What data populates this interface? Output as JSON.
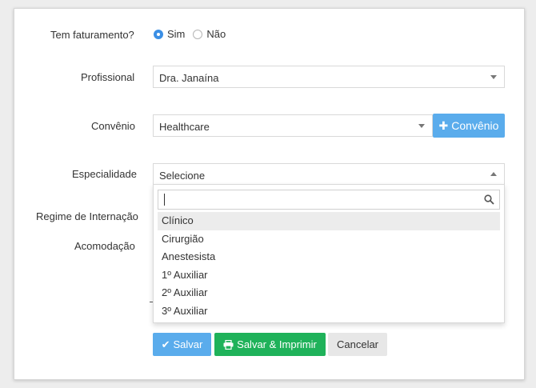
{
  "form": {
    "billing": {
      "label": "Tem faturamento?",
      "options": [
        {
          "label": "Sim",
          "selected": true
        },
        {
          "label": "Não",
          "selected": false
        }
      ]
    },
    "professional": {
      "label": "Profissional",
      "value": "Dra. Janaína"
    },
    "insurance": {
      "label": "Convênio",
      "value": "Healthcare",
      "add_button": "Convênio",
      "add_icon": "plus-icon"
    },
    "specialty": {
      "label": "Especialidade",
      "value": "Selecione",
      "search_value": "",
      "options": [
        "Clínico",
        "Cirurgião",
        "Anestesista",
        "1º Auxiliar",
        "2º Auxiliar",
        "3º Auxiliar"
      ],
      "highlighted": "Clínico"
    },
    "hospitalization_label": "Regime de Internação",
    "accommodation_label": "Acomodação"
  },
  "actions": {
    "save": "Salvar",
    "save_print": "Salvar & Imprimir",
    "cancel": "Cancelar"
  },
  "colors": {
    "primary": "#5aacec",
    "success": "#1fb25a",
    "radio_selected": "#3b8fe5"
  }
}
